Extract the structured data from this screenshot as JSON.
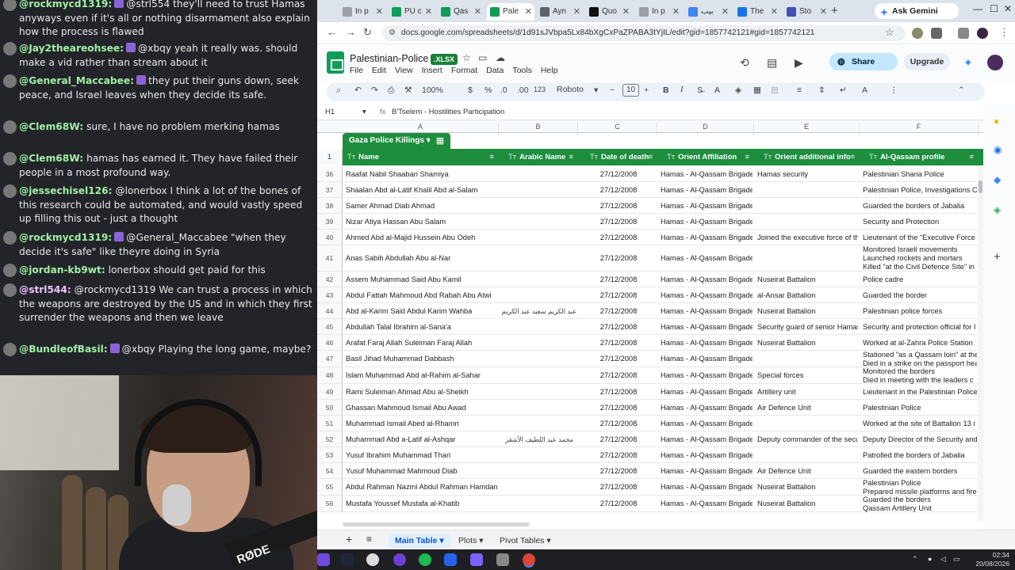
{
  "chat": {
    "messages": [
      {
        "user": "@rockmycd1319:",
        "text": "@strl554 they'll need to trust Hamas anyways even if it's all or nothing disarmament also explain how the process is flawed",
        "emote": true,
        "color": "#9ff0a3"
      },
      {
        "user": "@Jay2theareohsee:",
        "text": "@xbqy yeah it really was. should make a vid rather than stream about it",
        "emote": true,
        "color": "#9ff0a3"
      },
      {
        "user": "@General_Maccabee:",
        "text": "they put their guns down, seek peace, and Israel leaves when they decide its safe.",
        "emote": true,
        "color": "#9ff0a3"
      },
      {
        "user": "@Clem68W:",
        "text": "sure, I have no problem merking hamas",
        "emote": false,
        "color": "#9ff0a3"
      },
      {
        "user": "@Clem68W:",
        "text": "hamas has earned it. They have failed their people in a most profound way.",
        "emote": false,
        "color": "#9ff0a3"
      },
      {
        "user": "@jessechisel126:",
        "text": "@lonerbox I think a lot of the bones of this research could be automated, and would vastly speed up filling this out - just a thought",
        "emote": false,
        "color": "#9ff0a3"
      },
      {
        "user": "@rockmycd1319:",
        "text": "@General_Maccabee \"when they decide it's safe\" like theyre doing in Syria",
        "emote": true,
        "color": "#9ff0a3"
      },
      {
        "user": "@jordan-kb9wt:",
        "text": "lonerbox should get paid for this",
        "emote": false,
        "color": "#9ff0a3"
      },
      {
        "user": "@strl544:",
        "text": "@rockmycd1319 We can trust a process in which the weapons are destroyed by the US and in which they first surrender the weapons and then we leave",
        "emote": false,
        "color": "#f1c0ff"
      },
      {
        "user": "@BundleofBasil:",
        "text": "@xbqy Playing the long game, maybe?",
        "emote": true,
        "color": "#9ff0a3"
      }
    ]
  },
  "webcam": {
    "mic_brand": "RØDE"
  },
  "browser": {
    "tabs": [
      {
        "label": "In p",
        "color": "#9aa0a6"
      },
      {
        "label": "PU c",
        "color": "#0f9d58"
      },
      {
        "label": "Qas",
        "color": "#0f9d58"
      },
      {
        "label": "Pale",
        "color": "#0f9d58"
      },
      {
        "label": "Ayn",
        "color": "#5f6368"
      },
      {
        "label": "Quo",
        "color": "#111111"
      },
      {
        "label": "In p",
        "color": "#9aa0a6"
      },
      {
        "label": "ﺑﻴﺐ",
        "color": "#4285f4"
      },
      {
        "label": "The",
        "color": "#1a73e8"
      },
      {
        "label": "Sto",
        "color": "#3f51b5"
      }
    ],
    "new_tab": "+",
    "gemini_label": "Ask Gemini",
    "url": "docs.google.com/spreadsheets/d/1d91sJVbpa5Lx84bXgCxPaZPABA3tYjIL/edit?gid=1857742121#gid=1857742121"
  },
  "sheets": {
    "doc_title": "Palestinian-Police",
    "badge": ".XLSX",
    "menus": [
      "File",
      "Edit",
      "View",
      "Insert",
      "Format",
      "Data",
      "Tools",
      "Help"
    ],
    "share_label": "Share",
    "upgrade_label": "Upgrade",
    "toolbar": {
      "zoom": "100%",
      "currency": "$",
      "percent": "%",
      "dec_less": ".0",
      "dec_more": ".00",
      "numfmt": "123",
      "font": "Roboto",
      "font_size": "10",
      "bold": "B",
      "italic": "I"
    },
    "formula_bar": {
      "cell_ref": "H1",
      "fx": "fx",
      "content": "B'Tselem - Hostilities Participation"
    },
    "columns": [
      "A",
      "B",
      "C",
      "D",
      "E",
      "F"
    ],
    "table_name": "Gaza Police Killings",
    "header_row_num": "1",
    "headers": [
      "Name",
      "Arabic Name",
      "Date of death",
      "Orient Affiliation",
      "Orient additional info",
      "Al-Qassam profile"
    ],
    "header_type_icon": "Tт",
    "rows": [
      {
        "n": "36",
        "name": "Raafat Nabil Shaaban Shamiya",
        "arabic": "",
        "date": "27/12/2008",
        "aff": "Hamas - Al-Qassam Brigades",
        "info": "Hamas security",
        "profile": "Palestinian Sharia Police"
      },
      {
        "n": "37",
        "name": "Shaalan Abd al-Latif Khalil Abd al-Salam",
        "arabic": "",
        "date": "27/12/2008",
        "aff": "Hamas - Al-Qassam Brigades",
        "info": "",
        "profile": "Palestinian Police, Investigations C"
      },
      {
        "n": "38",
        "name": "Samer Ahmad Diab Ahmad",
        "arabic": "",
        "date": "27/12/2008",
        "aff": "Hamas - Al-Qassam Brigades",
        "info": "",
        "profile": "Guarded the borders of Jabalia"
      },
      {
        "n": "39",
        "name": "Nizar Atiya Hassan Abu Salam",
        "arabic": "",
        "date": "27/12/2008",
        "aff": "Hamas - Al-Qassam Brigades",
        "info": "",
        "profile": "Security and Protection"
      },
      {
        "n": "40",
        "name": "Ahmed Abd al-Majid Hussein Abu Odeh",
        "arabic": "",
        "date": "27/12/2008",
        "aff": "Hamas - Al-Qassam Brigades",
        "info": "Joined the executive force of the",
        "profile": "Lieutenant of the \"Executive Force"
      },
      {
        "n": "41",
        "name": "Anas Sabih Abdullah Abu al-Nar",
        "arabic": "",
        "date": "27/12/2008",
        "aff": "Hamas - Al-Qassam Brigades",
        "info": "",
        "profile": "Monitored Israeli movements\nLaunched rockets and mortars\nKilled \"at the Civil Defence Site\" in a"
      },
      {
        "n": "42",
        "name": "Assem Muhammad Said Abu Kamil",
        "arabic": "",
        "date": "27/12/2008",
        "aff": "Hamas - Al-Qassam Brigades",
        "info": "Nuseirat Battalion",
        "profile": "Police cadre"
      },
      {
        "n": "43",
        "name": "Abdul Fattah Mahmoud Abd Rabah Abu Atwi",
        "arabic": "",
        "date": "27/12/2008",
        "aff": "Hamas - Al-Qassam Brigades",
        "info": "al-Ansar Battalion",
        "profile": "Guarded the border"
      },
      {
        "n": "44",
        "name": "Abd al-Karim Said Abdul Karim Wahba",
        "arabic": "عبد الكريم سعيد عبد الكريم وهبة",
        "date": "27/12/2008",
        "aff": "Hamas - Al-Qassam Brigades",
        "info": "Nuseirat Battalion",
        "profile": "Palestinian police forces"
      },
      {
        "n": "45",
        "name": "Abdullah Talal Ibrahim al-Sana'a",
        "arabic": "",
        "date": "27/12/2008",
        "aff": "Hamas - Al-Qassam Brigades",
        "info": "Security guard of senior Hamas",
        "profile": "Security and protection official for I"
      },
      {
        "n": "46",
        "name": "Arafat Faraj Allah Suleiman Faraj Allah",
        "arabic": "",
        "date": "27/12/2008",
        "aff": "Hamas - Al-Qassam Brigades",
        "info": "Nuseirat Battalion",
        "profile": "Worked at al-Zahra Police Station"
      },
      {
        "n": "47",
        "name": "Basil Jihad Muhammad Dabbash",
        "arabic": "",
        "date": "27/12/2008",
        "aff": "Hamas - Al-Qassam Brigades",
        "info": "",
        "profile": "Stationed \"as a Qassam loin\" at the\nDied in a strike on the passport hea"
      },
      {
        "n": "48",
        "name": "Islam Muhammad Abd al-Rahim al-Sahar",
        "arabic": "",
        "date": "27/12/2008",
        "aff": "Hamas - Al-Qassam Brigades",
        "info": "Special forces",
        "profile": "Monitored the borders\nDied in meeting with the leaders c"
      },
      {
        "n": "49",
        "name": "Rami Suleiman Ahmad Abu al-Sheikh",
        "arabic": "",
        "date": "27/12/2008",
        "aff": "Hamas - Al-Qassam Brigades",
        "info": "Artillery unit",
        "profile": "Lieutenant in the Palestinian Police"
      },
      {
        "n": "50",
        "name": "Ghassan Mahmoud Ismail Abu Awad",
        "arabic": "",
        "date": "27/12/2008",
        "aff": "Hamas - Al-Qassam Brigades",
        "info": "Air Defence Unit",
        "profile": "Palestinian Police"
      },
      {
        "n": "51",
        "name": "Muhammad Ismail Abed al-Rhamri",
        "arabic": "",
        "date": "27/12/2008",
        "aff": "Hamas - Al-Qassam Brigades",
        "info": "",
        "profile": "Worked at the site of Battalion 13 i"
      },
      {
        "n": "52",
        "name": "Muhammad Abd a-Latif al-Ashqar",
        "arabic": "محمد عبد اللطيف الأشقر",
        "date": "27/12/2008",
        "aff": "Hamas - Al-Qassam Brigades",
        "info": "Deputy commander of the secur",
        "profile": "Deputy Director of the Security and"
      },
      {
        "n": "53",
        "name": "Yusuf Ibrahim Muhammad Thari",
        "arabic": "",
        "date": "27/12/2008",
        "aff": "Hamas - Al-Qassam Brigades",
        "info": "",
        "profile": "Patrolled the borders of Jabalia"
      },
      {
        "n": "54",
        "name": "Yusuf Muhammad Mahmoud Diab",
        "arabic": "",
        "date": "27/12/2008",
        "aff": "Hamas - Al-Qassam Brigades",
        "info": "Air Defence Unit",
        "profile": "Guarded the eastern borders"
      },
      {
        "n": "55",
        "name": "Abdul Rahman Nazmi Abdul Rahman Hamdan",
        "arabic": "",
        "date": "27/12/2008",
        "aff": "Hamas - Al-Qassam Brigades",
        "info": "Nuseirat Battalion",
        "profile": "Palestinian Police\nPrepared missile platforms and fire"
      },
      {
        "n": "56",
        "name": "Mustafa Youssef Mustafa al-Khatib",
        "arabic": "",
        "date": "27/12/2008",
        "aff": "Hamas - Al-Qassam Brigades",
        "info": "Nuseirat Battalion",
        "profile": "Guarded the borders\nQassam Artillery Unit"
      }
    ],
    "sheet_tabs": [
      {
        "label": "Main Table",
        "active": true
      },
      {
        "label": "Plots",
        "active": false
      },
      {
        "label": "Pivot Tables",
        "active": false
      }
    ]
  },
  "taskbar": {
    "time": "02:34",
    "date": "20/08/2026"
  },
  "colors": {
    "table_green": "#1e8e3e",
    "share_blue": "#c2e7ff",
    "active_tab_blue": "#0b57d0"
  }
}
